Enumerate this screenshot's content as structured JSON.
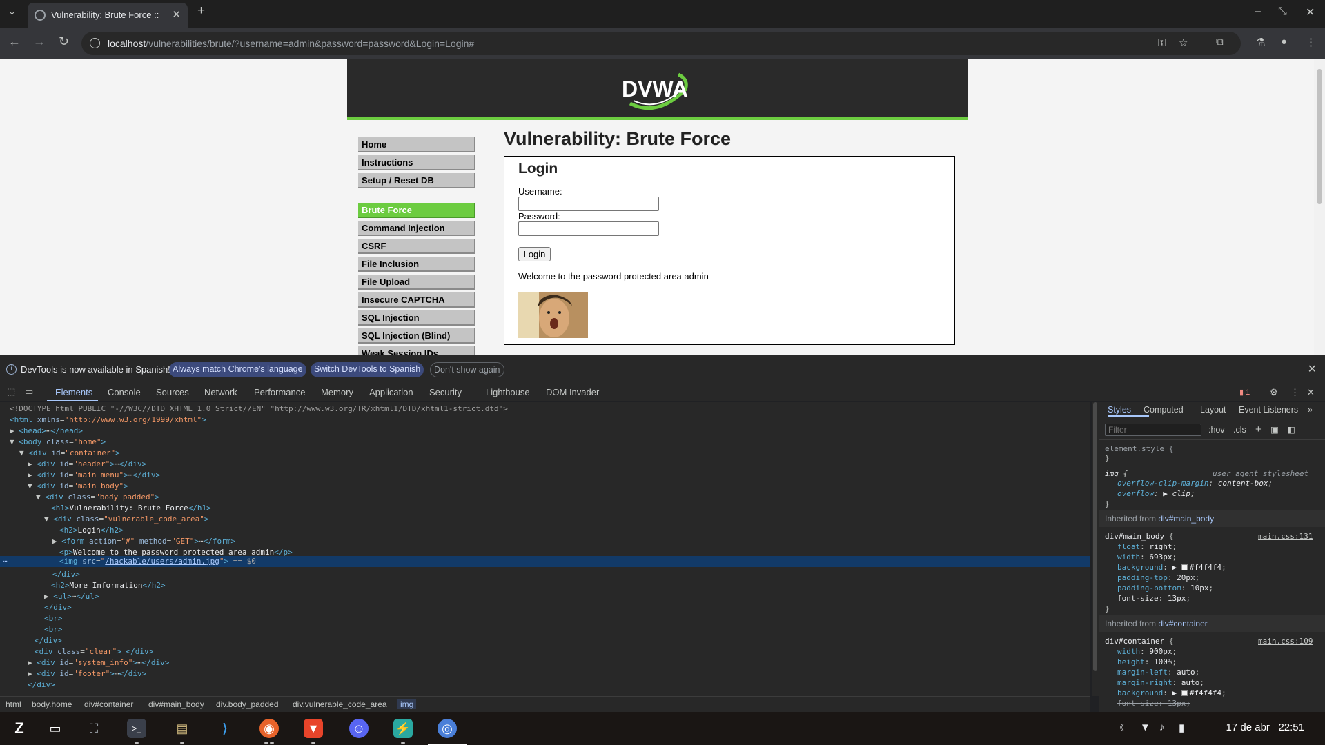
{
  "browser": {
    "tab_title": "Vulnerability: Brute Force :: ",
    "url_host": "localhost",
    "url_path": "/vulnerabilities/brute/?username=admin&password=password&Login=Login#"
  },
  "page": {
    "logo_text": "DVWA",
    "menu": [
      {
        "label": "Home"
      },
      {
        "label": "Instructions"
      },
      {
        "label": "Setup / Reset DB"
      },
      {
        "label": "Brute Force"
      },
      {
        "label": "Command Injection"
      },
      {
        "label": "CSRF"
      },
      {
        "label": "File Inclusion"
      },
      {
        "label": "File Upload"
      },
      {
        "label": "Insecure CAPTCHA"
      },
      {
        "label": "SQL Injection"
      },
      {
        "label": "SQL Injection (Blind)"
      },
      {
        "label": "Weak Session IDs"
      }
    ],
    "title": "Vulnerability: Brute Force",
    "login_heading": "Login",
    "username_label": "Username:",
    "password_label": "Password:",
    "login_button": "Login",
    "welcome": "Welcome to the password protected area admin"
  },
  "devtools_banner": {
    "message": "DevTools is now available in Spanish!",
    "btn_match": "Always match Chrome's language",
    "btn_switch": "Switch DevTools to Spanish",
    "btn_dismiss": "Don't show again"
  },
  "devtools_tabs": [
    "Elements",
    "Console",
    "Sources",
    "Network",
    "Performance",
    "Memory",
    "Application",
    "Security",
    "Lighthouse",
    "DOM Invader"
  ],
  "issues_count": "1",
  "dom": {
    "doctype": "<!DOCTYPE html PUBLIC \"-//W3C//DTD XHTML 1.0 Strict//EN\" \"http://www.w3.org/TR/xhtml1/DTD/xhtml1-strict.dtd\">",
    "h1_text": "Vulnerability: Brute Force",
    "h2_login": "Login",
    "p_text": "Welcome to the password protected area admin",
    "img_src": "/hackable/users/admin.jpg",
    "selected_marker": "== $0",
    "h2_more": "More Information"
  },
  "breadcrumb": [
    "html",
    "body.home",
    "div#container",
    "div#main_body",
    "div.body_padded",
    "div.vulnerable_code_area",
    "img"
  ],
  "styles": {
    "subtabs": [
      "Styles",
      "Computed",
      "Layout",
      "Event Listeners"
    ],
    "filter_placeholder": "Filter",
    "hov": ":hov",
    "cls": ".cls",
    "element_style": "element.style {",
    "ua_label": "user agent stylesheet",
    "inherited_main": "div#main_body",
    "main_src": "main.css:131",
    "inherited_container": "div#container",
    "container_src": "main.css:109"
  },
  "taskbar": {
    "date": "17 de abr",
    "time": "22:51"
  }
}
